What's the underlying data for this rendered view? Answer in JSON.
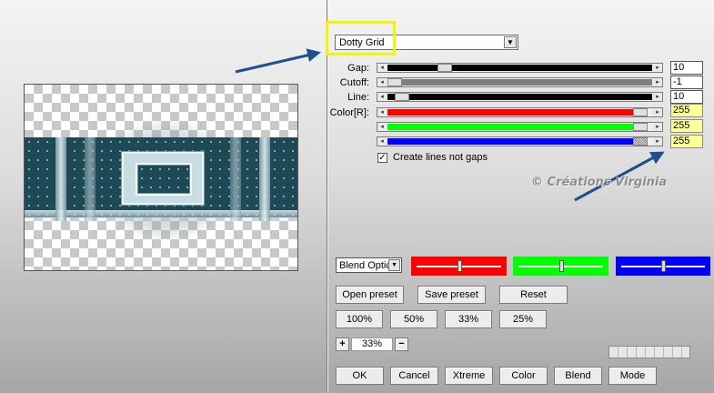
{
  "preset": {
    "selected": "Dotty Grid"
  },
  "params": [
    {
      "label": "Gap:",
      "value": "10",
      "fill_color": "#000000",
      "thumb_fraction": 0.2
    },
    {
      "label": "Cutoff:",
      "value": "-1",
      "fill_color": "#7f7f7f",
      "thumb_fraction": 0.0
    },
    {
      "label": "Line:",
      "value": "10",
      "fill_color": "#000000",
      "thumb_fraction": 0.03
    }
  ],
  "color": {
    "label": "Color[R]:",
    "channels": [
      {
        "name": "red",
        "value": "255",
        "fill_color": "#ff0000"
      },
      {
        "name": "green",
        "value": "255",
        "fill_color": "#00ff00"
      },
      {
        "name": "blue",
        "value": "255",
        "fill_color": "#0000ff"
      }
    ]
  },
  "checkbox": {
    "label": "Create lines not gaps",
    "checked": true
  },
  "watermark": "© Créations Virginia",
  "blend": {
    "select_value": "Blend Optic"
  },
  "swatches": [
    {
      "name": "red",
      "color": "#ff0000",
      "knob_fraction": 0.5
    },
    {
      "name": "green",
      "color": "#00ff00",
      "knob_fraction": 0.5
    },
    {
      "name": "blue",
      "color": "#0000ff",
      "knob_fraction": 0.5
    }
  ],
  "buttons": {
    "open_preset": "Open preset",
    "save_preset": "Save preset",
    "reset": "Reset",
    "zoom_100": "100%",
    "zoom_50": "50%",
    "zoom_33": "33%",
    "zoom_25": "25%",
    "zoom_plus": "+",
    "zoom_minus": "−",
    "ok": "OK",
    "cancel": "Cancel",
    "xtreme": "Xtreme",
    "color": "Color",
    "blend": "Blend",
    "mode": "Mode"
  },
  "zoom": {
    "value": "33%"
  },
  "colors": {
    "highlight": "#f2f20a",
    "arrow": "#1f4f8f"
  }
}
